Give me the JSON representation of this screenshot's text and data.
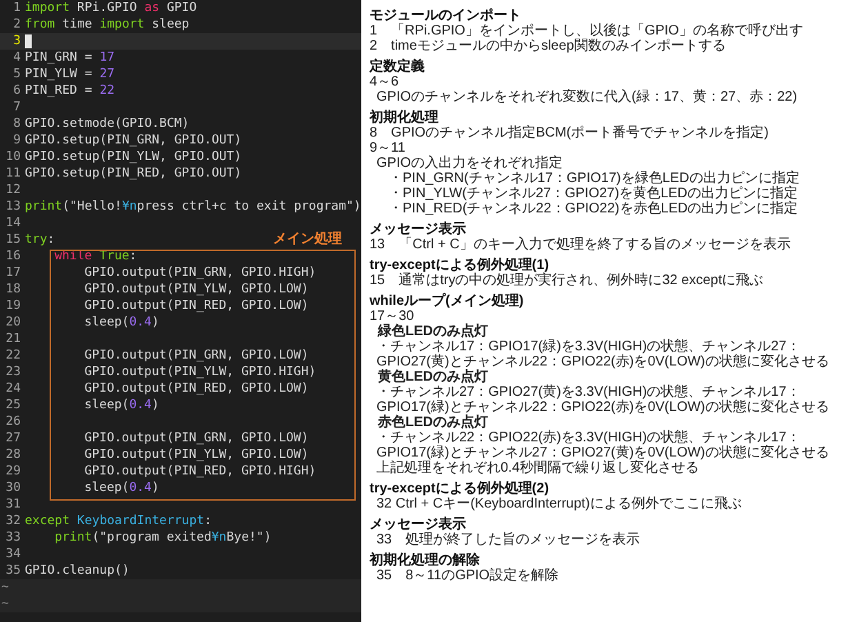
{
  "editor": {
    "lines": [
      {
        "number": "1",
        "current": false,
        "tokens": [
          {
            "text": "import",
            "kind": "keyword"
          },
          {
            "text": " RPi.GPIO ",
            "kind": "plain"
          },
          {
            "text": "as",
            "kind": "special"
          },
          {
            "text": " GPIO",
            "kind": "plain"
          }
        ]
      },
      {
        "number": "2",
        "current": false,
        "tokens": [
          {
            "text": "from",
            "kind": "keyword"
          },
          {
            "text": " time ",
            "kind": "plain"
          },
          {
            "text": "import",
            "kind": "keyword"
          },
          {
            "text": " sleep",
            "kind": "plain"
          }
        ]
      },
      {
        "number": "3",
        "current": true
      },
      {
        "number": "4",
        "current": false,
        "tokens": [
          {
            "text": "PIN_GRN = ",
            "kind": "plain"
          },
          {
            "text": "17",
            "kind": "number"
          }
        ]
      },
      {
        "number": "5",
        "current": false,
        "tokens": [
          {
            "text": "PIN_YLW = ",
            "kind": "plain"
          },
          {
            "text": "27",
            "kind": "number"
          }
        ]
      },
      {
        "number": "6",
        "current": false,
        "tokens": [
          {
            "text": "PIN_RED = ",
            "kind": "plain"
          },
          {
            "text": "22",
            "kind": "number"
          }
        ]
      },
      {
        "number": "7",
        "current": false
      },
      {
        "number": "8",
        "current": false,
        "tokens": [
          {
            "text": "GPIO.setmode(GPIO.BCM)",
            "kind": "plain"
          }
        ]
      },
      {
        "number": "9",
        "current": false,
        "tokens": [
          {
            "text": "GPIO.setup(PIN_GRN, GPIO.OUT)",
            "kind": "plain"
          }
        ]
      },
      {
        "number": "10",
        "current": false,
        "tokens": [
          {
            "text": "GPIO.setup(PIN_YLW, GPIO.OUT)",
            "kind": "plain"
          }
        ]
      },
      {
        "number": "11",
        "current": false,
        "tokens": [
          {
            "text": "GPIO.setup(PIN_RED, GPIO.OUT)",
            "kind": "plain"
          }
        ]
      },
      {
        "number": "12",
        "current": false
      },
      {
        "number": "13",
        "current": false,
        "tokens": [
          {
            "text": "print",
            "kind": "keyword"
          },
          {
            "text": "(\"Hello!",
            "kind": "plain"
          },
          {
            "text": "¥n",
            "kind": "escape"
          },
          {
            "text": "press ctrl+c to exit program\")",
            "kind": "plain"
          }
        ]
      },
      {
        "number": "14",
        "current": false
      },
      {
        "number": "15",
        "current": false,
        "tokens": [
          {
            "text": "try",
            "kind": "keyword"
          },
          {
            "text": ":",
            "kind": "plain"
          }
        ],
        "children": [
          {
            "number": "16",
            "current": false,
            "annotation": "メイン処理",
            "tokens": [
              {
                "text": "while",
                "kind": "special"
              },
              {
                "text": " True",
                "kind": "keyword"
              },
              {
                "text": ":",
                "kind": "plain"
              }
            ],
            "children": [
              {
                "number": "17",
                "current": false,
                "tokens": [
                  {
                    "text": "GPIO.output(PIN_GRN, GPIO.HIGH)",
                    "kind": "plain"
                  }
                ]
              },
              {
                "number": "18",
                "current": false,
                "tokens": [
                  {
                    "text": "GPIO.output(PIN_YLW, GPIO.LOW)",
                    "kind": "plain"
                  }
                ]
              },
              {
                "number": "19",
                "current": false,
                "tokens": [
                  {
                    "text": "GPIO.output(PIN_RED, GPIO.LOW)",
                    "kind": "plain"
                  }
                ]
              },
              {
                "number": "20",
                "current": false,
                "tokens": [
                  {
                    "text": "sleep(",
                    "kind": "plain"
                  },
                  {
                    "text": "0.4",
                    "kind": "number"
                  },
                  {
                    "text": ")",
                    "kind": "plain"
                  }
                ]
              },
              {
                "number": "21",
                "current": false
              },
              {
                "number": "22",
                "current": false,
                "tokens": [
                  {
                    "text": "GPIO.output(PIN_GRN, GPIO.LOW)",
                    "kind": "plain"
                  }
                ]
              },
              {
                "number": "23",
                "current": false,
                "tokens": [
                  {
                    "text": "GPIO.output(PIN_YLW, GPIO.HIGH)",
                    "kind": "plain"
                  }
                ]
              },
              {
                "number": "24",
                "current": false,
                "tokens": [
                  {
                    "text": "GPIO.output(PIN_RED, GPIO.LOW)",
                    "kind": "plain"
                  }
                ]
              },
              {
                "number": "25",
                "current": false,
                "tokens": [
                  {
                    "text": "sleep(",
                    "kind": "plain"
                  },
                  {
                    "text": "0.4",
                    "kind": "number"
                  },
                  {
                    "text": ")",
                    "kind": "plain"
                  }
                ]
              },
              {
                "number": "26",
                "current": false
              },
              {
                "number": "27",
                "current": false,
                "tokens": [
                  {
                    "text": "GPIO.output(PIN_GRN, GPIO.LOW)",
                    "kind": "plain"
                  }
                ]
              },
              {
                "number": "28",
                "current": false,
                "tokens": [
                  {
                    "text": "GPIO.output(PIN_YLW, GPIO.LOW)",
                    "kind": "plain"
                  }
                ]
              },
              {
                "number": "29",
                "current": false,
                "tokens": [
                  {
                    "text": "GPIO.output(PIN_RED, GPIO.HIGH)",
                    "kind": "plain"
                  }
                ]
              },
              {
                "number": "30",
                "current": false,
                "tokens": [
                  {
                    "text": "sleep(",
                    "kind": "plain"
                  },
                  {
                    "text": "0.4",
                    "kind": "number"
                  },
                  {
                    "text": ")",
                    "kind": "plain"
                  }
                ]
              }
            ]
          }
        ]
      },
      {
        "number": "31",
        "current": false
      },
      {
        "number": "32",
        "current": false,
        "tokens": [
          {
            "text": "except",
            "kind": "keyword"
          },
          {
            "text": " KeyboardInterrupt",
            "kind": "class"
          },
          {
            "text": ":",
            "kind": "plain"
          }
        ],
        "children": [
          {
            "number": "33",
            "current": false,
            "tokens": [
              {
                "text": "print",
                "kind": "keyword"
              },
              {
                "text": "(\"program exited",
                "kind": "plain"
              },
              {
                "text": "¥n",
                "kind": "escape"
              },
              {
                "text": "Bye!\")",
                "kind": "plain"
              }
            ]
          }
        ]
      },
      {
        "number": "34",
        "current": false
      },
      {
        "number": "35",
        "current": false,
        "tokens": [
          {
            "text": "GPIO.cleanup()",
            "kind": "plain"
          }
        ]
      }
    ],
    "empty_markers": [
      "~",
      "~"
    ]
  },
  "notes": {
    "sections": [
      {
        "heading": "モジュールのインポート",
        "lines": [
          {
            "kind": "line",
            "text": "1　「RPi.GPIO」をインポートし、以後は「GPIO」の名称で呼び出す"
          },
          {
            "kind": "line",
            "text": "2　timeモジュールの中からsleep関数のみインポートする"
          }
        ]
      },
      {
        "heading": "定数定義",
        "lines": [
          {
            "kind": "line",
            "text": "4～6"
          },
          {
            "kind": "detail",
            "text": "GPIOのチャンネルをそれぞれ変数に代入(緑：17、黄：27、赤：22)"
          }
        ]
      },
      {
        "heading": "初期化処理",
        "lines": [
          {
            "kind": "line",
            "text": "8　GPIOのチャンネル指定BCM(ポート番号でチャンネルを指定)"
          },
          {
            "kind": "line",
            "text": "9～11"
          },
          {
            "kind": "detail",
            "text": "GPIOの入出力をそれぞれ指定"
          },
          {
            "kind": "bullet",
            "text": "・PIN_GRN(チャンネル17：GPIO17)を緑色LEDの出力ピンに指定"
          },
          {
            "kind": "bullet",
            "text": "・PIN_YLW(チャンネル27：GPIO27)を黄色LEDの出力ピンに指定"
          },
          {
            "kind": "bullet",
            "text": "・PIN_RED(チャンネル22：GPIO22)を赤色LEDの出力ピンに指定"
          }
        ]
      },
      {
        "heading": "メッセージ表示",
        "lines": [
          {
            "kind": "line",
            "text": "13　「Ctrl + C」のキー入力で処理を終了する旨のメッセージを表示"
          }
        ]
      },
      {
        "heading": "try-exceptによる例外処理(1)",
        "lines": [
          {
            "kind": "line",
            "text": "15　通常はtryの中の処理が実行され、例外時に32 exceptに飛ぶ"
          }
        ]
      },
      {
        "heading": "whileループ(メイン処理)",
        "lines": [
          {
            "kind": "line",
            "text": "17～30"
          },
          {
            "kind": "subheading",
            "text": "緑色LEDのみ点灯"
          },
          {
            "kind": "detail",
            "text": "・チャンネル17：GPIO17(緑)を3.3V(HIGH)の状態、チャンネル27：GPIO27(黄)とチャンネル22：GPIO22(赤)を0V(LOW)の状態に変化させる"
          },
          {
            "kind": "subheading",
            "text": "黄色LEDのみ点灯"
          },
          {
            "kind": "detail",
            "text": "・チャンネル27：GPIO27(黄)を3.3V(HIGH)の状態、チャンネル17：GPIO17(緑)とチャンネル22：GPIO22(赤)を0V(LOW)の状態に変化させる"
          },
          {
            "kind": "subheading",
            "text": "赤色LEDのみ点灯"
          },
          {
            "kind": "detail",
            "text": "・チャンネル22：GPIO22(赤)を3.3V(HIGH)の状態、チャンネル17：GPIO17(緑)とチャンネル27：GPIO27(黄)を0V(LOW)の状態に変化させる"
          },
          {
            "kind": "detail",
            "text": "上記処理をそれぞれ0.4秒間隔で繰り返し変化させる"
          }
        ]
      },
      {
        "heading": "try-exceptによる例外処理(2)",
        "lines": [
          {
            "kind": "detail",
            "text": "32 Ctrl + Cキー(KeyboardInterrupt)による例外でここに飛ぶ"
          }
        ]
      },
      {
        "heading": "メッセージ表示",
        "lines": [
          {
            "kind": "detail",
            "text": "33　処理が終了した旨のメッセージを表示"
          }
        ]
      },
      {
        "heading": "初期化処理の解除",
        "lines": [
          {
            "kind": "detail",
            "text": "35　8～11のGPIO設定を解除"
          }
        ]
      }
    ]
  }
}
